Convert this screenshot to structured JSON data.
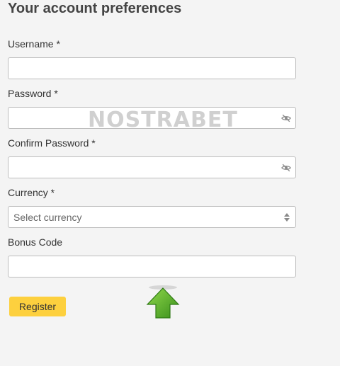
{
  "form": {
    "title": "Your account preferences",
    "username": {
      "label": "Username *",
      "value": "",
      "placeholder": ""
    },
    "password": {
      "label": "Password *",
      "value": "",
      "placeholder": ""
    },
    "confirm_password": {
      "label": "Confirm Password *",
      "value": "",
      "placeholder": ""
    },
    "currency": {
      "label": "Currency *",
      "selected": "Select currency"
    },
    "bonus_code": {
      "label": "Bonus Code",
      "value": "",
      "placeholder": ""
    },
    "register_label": "Register"
  },
  "watermark": {
    "text": "NOSTRABET"
  },
  "icons": {
    "password_toggle": "eye-slash-icon",
    "select_caret": "sort-arrows-icon",
    "pointer": "green-arrow-up-icon"
  },
  "colors": {
    "background": "#f4f4f4",
    "button": "#fdd03e",
    "field_border": "#bdbdbd",
    "arrow": "#4ea826"
  }
}
